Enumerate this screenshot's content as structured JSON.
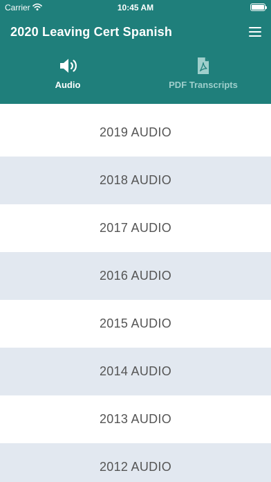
{
  "status": {
    "carrier": "Carrier",
    "time": "10:45 AM"
  },
  "app": {
    "title": "2020 Leaving Cert Spanish"
  },
  "tabs": [
    {
      "label": "Audio",
      "icon": "volume-icon"
    },
    {
      "label": "PDF Transcripts",
      "icon": "pdf-file-icon"
    }
  ],
  "list": [
    {
      "label": "2019 AUDIO"
    },
    {
      "label": "2018 AUDIO"
    },
    {
      "label": "2017 AUDIO"
    },
    {
      "label": "2016 AUDIO"
    },
    {
      "label": "2015 AUDIO"
    },
    {
      "label": "2014 AUDIO"
    },
    {
      "label": "2013 AUDIO"
    },
    {
      "label": "2012 AUDIO"
    }
  ],
  "colors": {
    "primary": "#1f7f7b",
    "indicator": "#8c7fc4",
    "stripe": "#e2e8f0"
  }
}
